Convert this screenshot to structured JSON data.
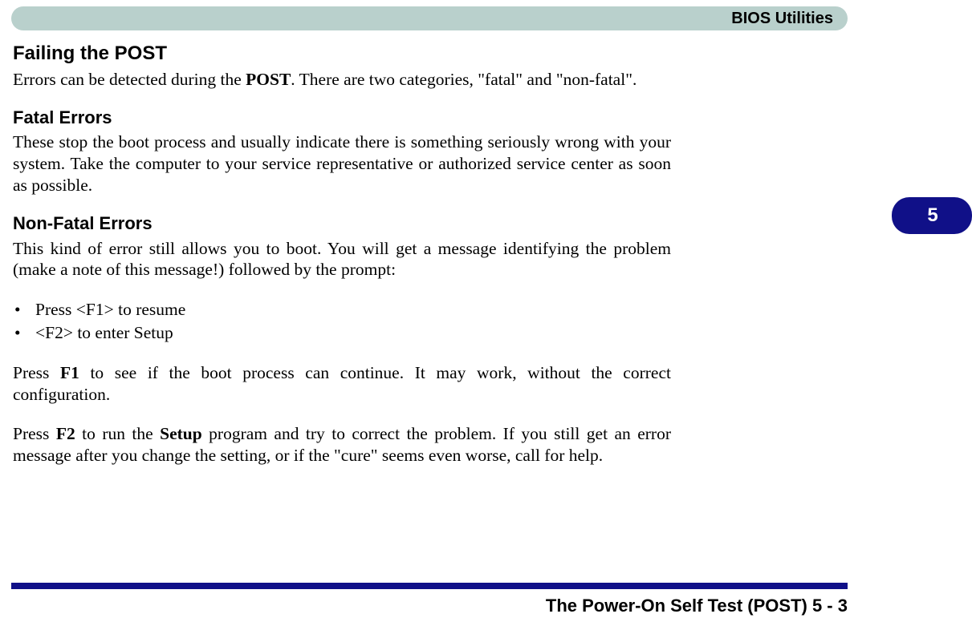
{
  "header": {
    "title": "BIOS Utilities"
  },
  "chapter_tab": "5",
  "sections": {
    "h1": "Failing the POST",
    "p1_a": "Errors can be detected during the ",
    "p1_bold": "POST",
    "p1_b": ". There are two categories, \"fatal\" and \"non-fatal\".",
    "h2a": "Fatal Errors",
    "p2": "These stop the boot process and usually indicate there is something seriously wrong with your system. Take the computer to your service representative or authorized service center as soon as possible.",
    "h2b": "Non-Fatal Errors",
    "p3": "This kind of error still allows you to boot. You will get a message identifying the problem (make a note of this message!) followed by the prompt:",
    "bullets": [
      "Press <F1> to resume",
      "<F2> to enter Setup"
    ],
    "p4_a": "Press ",
    "p4_bold": "F1",
    "p4_b": " to see if the boot process can continue. It may work, without the correct configuration.",
    "p5_a": "Press ",
    "p5_bold1": "F2",
    "p5_b": " to run the ",
    "p5_bold2": "Setup",
    "p5_c": " program and try to correct the problem. If you still get an error message after you change the setting, or if the \"cure\" seems even worse, call for help."
  },
  "footer": {
    "text": "The Power-On Self Test (POST)  5  -  3"
  }
}
